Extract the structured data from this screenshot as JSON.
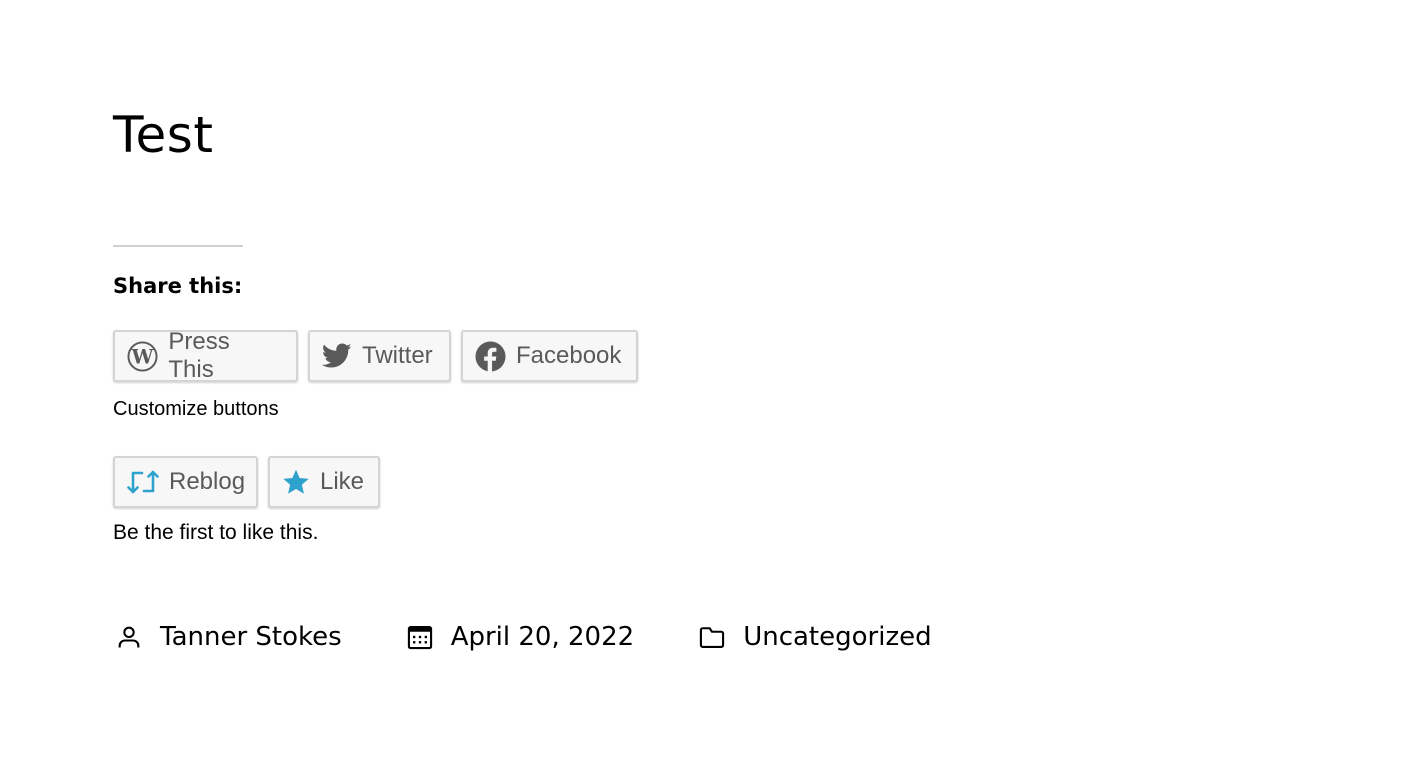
{
  "post": {
    "title": "Test"
  },
  "sharing": {
    "heading": "Share this:",
    "buttons": [
      {
        "label": "Press This",
        "icon": "wordpress-icon"
      },
      {
        "label": "Twitter",
        "icon": "twitter-icon"
      },
      {
        "label": "Facebook",
        "icon": "facebook-icon"
      }
    ],
    "customize_link": "Customize buttons"
  },
  "likes": {
    "reblog_label": "Reblog",
    "like_label": "Like",
    "note": "Be the first to like this.",
    "accent_color": "#2ea2cc"
  },
  "meta": {
    "author": "Tanner Stokes",
    "date": "April 20, 2022",
    "category": "Uncategorized"
  }
}
